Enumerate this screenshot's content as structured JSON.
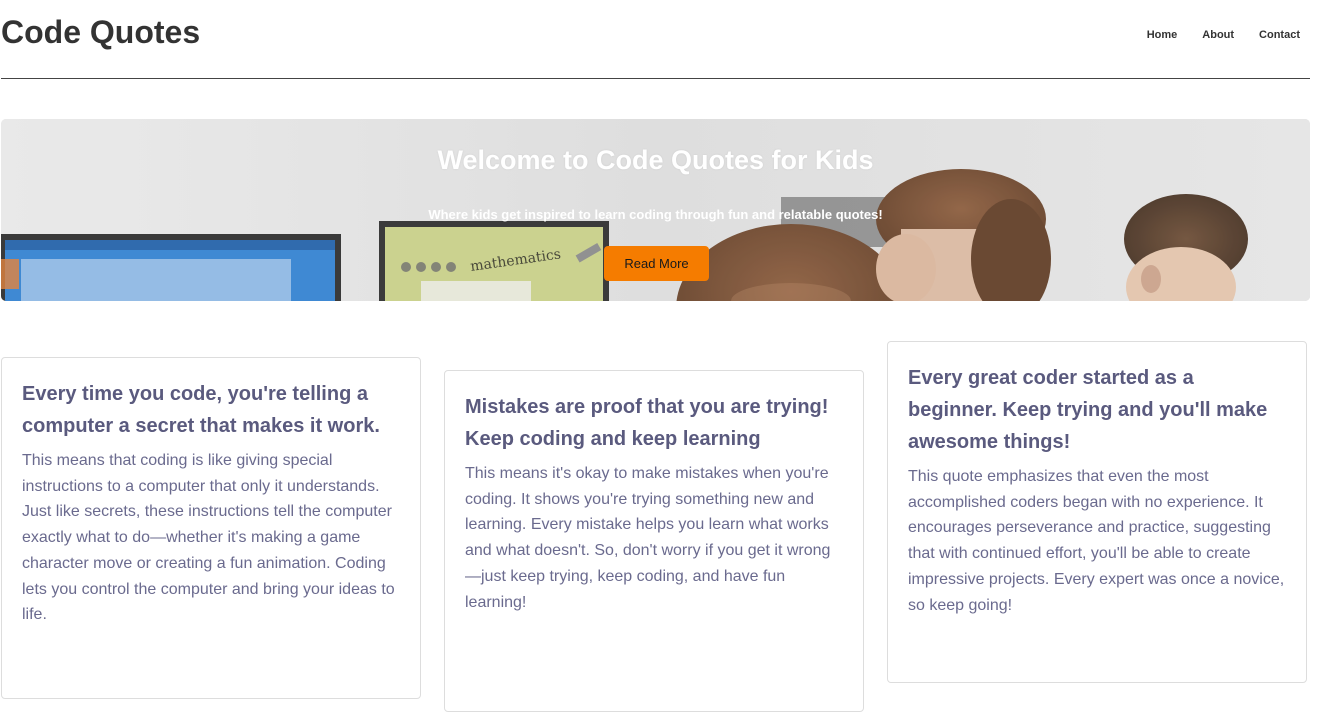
{
  "header": {
    "title": "Code Quotes",
    "nav": {
      "home": "Home",
      "about": "About",
      "contact": "Contact"
    }
  },
  "hero": {
    "title": "Welcome to Code Quotes for Kids",
    "subtitle": "Where kids get inspired to learn coding through fun and relatable quotes!",
    "button_label": "Read More",
    "button_color": "#f57c00",
    "screen_text": "mathematics"
  },
  "cards": [
    {
      "quote": "Every time you code, you're telling a computer a secret that makes it work.",
      "explanation": "This means that coding is like giving special instructions to a computer that only it understands. Just like secrets, these instructions tell the computer exactly what to do—whether it's making a game character move or creating a fun animation. Coding lets you control the computer and bring your ideas to life."
    },
    {
      "quote": "Mistakes are proof that you are trying! Keep coding and keep learning",
      "explanation": "This means it's okay to make mistakes when you're coding. It shows you're trying something new and learning. Every mistake helps you learn what works and what doesn't. So, don't worry if you get it wrong—just keep trying, keep coding, and have fun learning!"
    },
    {
      "quote": "Every great coder started as a beginner. Keep trying and you'll make awesome things!",
      "explanation": "This quote emphasizes that even the most accomplished coders began with no experience. It encourages perseverance and practice, suggesting that with continued effort, you'll be able to create impressive projects. Every expert was once a novice, so keep going!"
    }
  ],
  "colors": {
    "heading": "#5a5a7e",
    "body_text": "#6a6a8e",
    "accent": "#f57c00"
  }
}
